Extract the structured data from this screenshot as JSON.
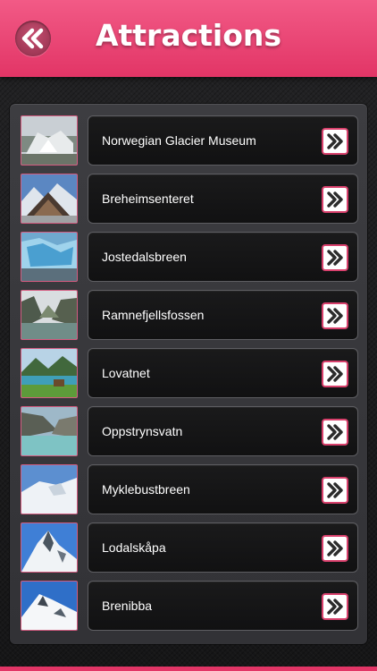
{
  "header": {
    "title": "Attractions",
    "back_icon": "double-chevron-left-icon",
    "color": "#e8416f"
  },
  "attractions": [
    {
      "label": "Norwegian Glacier Museum",
      "thumb": "museum-photo"
    },
    {
      "label": "Breheimsenteret",
      "thumb": "center-photo"
    },
    {
      "label": "Jostedalsbreen",
      "thumb": "glacier-photo"
    },
    {
      "label": "Ramnefjellsfossen",
      "thumb": "waterfall-photo"
    },
    {
      "label": "Lovatnet",
      "thumb": "lake-photo"
    },
    {
      "label": "Oppstrynsvatn",
      "thumb": "lake-photo"
    },
    {
      "label": "Myklebustbreen",
      "thumb": "snow-photo"
    },
    {
      "label": "Lodalskåpa",
      "thumb": "peak-photo"
    },
    {
      "label": "Brenibba",
      "thumb": "snow-peak-photo"
    }
  ],
  "row_action_icon": "double-chevron-right-icon"
}
